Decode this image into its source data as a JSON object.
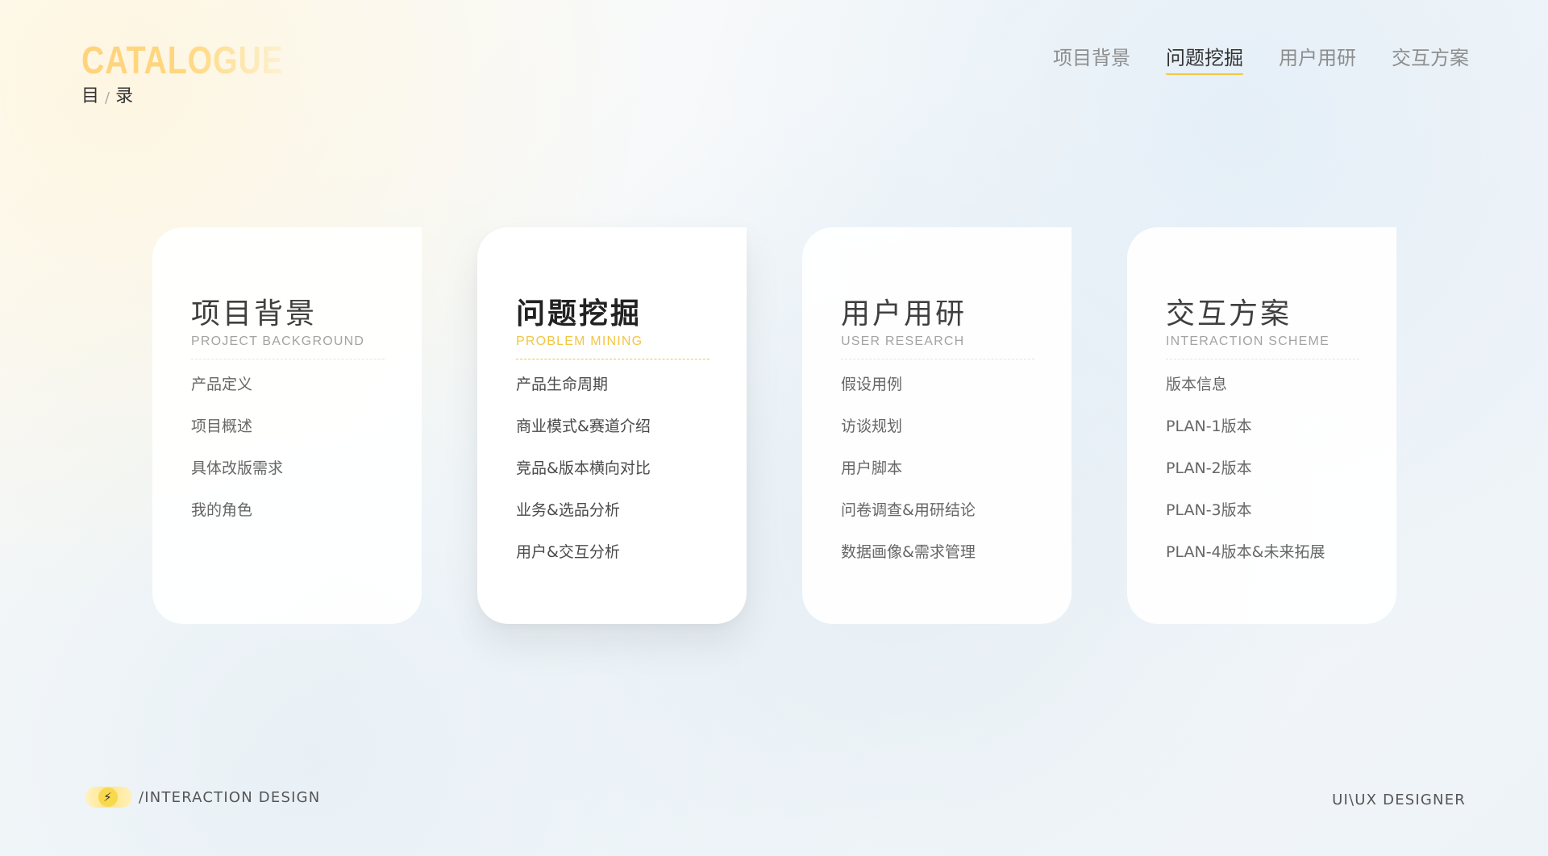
{
  "header": {
    "brand": {
      "title_en": "CATALOGUE",
      "title_cn_left": "目",
      "title_cn_sep": "/",
      "title_cn_right": "录"
    }
  },
  "nav": {
    "items": [
      {
        "label": "项目背景"
      },
      {
        "label": "问题挖掘"
      },
      {
        "label": "用户用研"
      },
      {
        "label": "交互方案"
      }
    ],
    "active_index": 1
  },
  "cards": [
    {
      "title": "项目背景",
      "subtitle": "PROJECT BACKGROUND",
      "items": [
        "产品定义",
        "项目概述",
        "具体改版需求",
        "我的角色"
      ]
    },
    {
      "title": "问题挖掘",
      "subtitle": "PROBLEM MINING",
      "items": [
        "产品生命周期",
        "商业模式&赛道介绍",
        "竞品&版本横向对比",
        "业务&选品分析",
        "用户&交互分析"
      ]
    },
    {
      "title": "用户用研",
      "subtitle": "USER RESEARCH",
      "items": [
        "假设用例",
        "访谈规划",
        "用户脚本",
        "问卷调查&用研结论",
        "数据画像&需求管理"
      ]
    },
    {
      "title": "交互方案",
      "subtitle": "INTERACTION SCHEME",
      "items": [
        "版本信息",
        "PLAN-1版本",
        "PLAN-2版本",
        "PLAN-3版本",
        "PLAN-4版本&未来拓展"
      ]
    }
  ],
  "footer": {
    "left_label": "/INTERACTION DESIGN",
    "right_label": "UI\\UX DESIGNER"
  },
  "icons": {
    "brand": "lightning-icon"
  },
  "colors": {
    "accent": "#f6c543"
  }
}
